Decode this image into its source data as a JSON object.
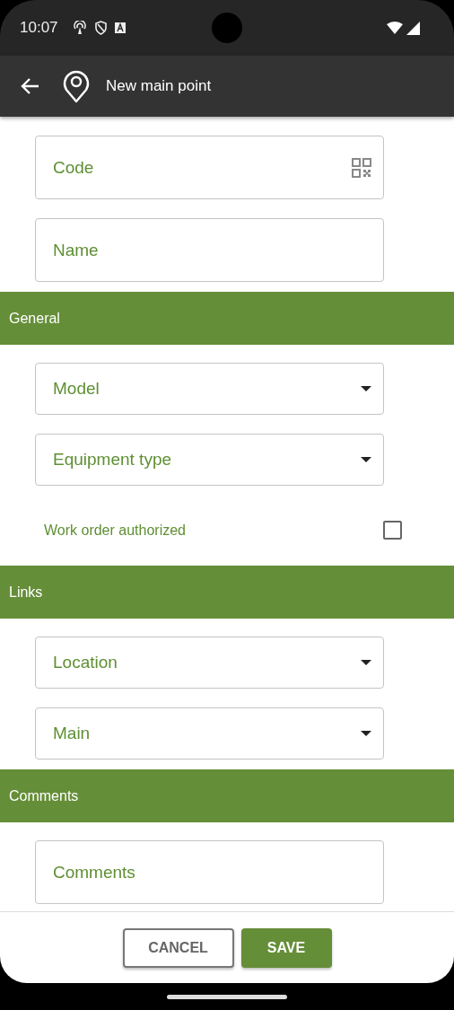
{
  "status_bar": {
    "time": "10:07"
  },
  "app_bar": {
    "title": "New main point"
  },
  "top_fields": [
    {
      "kind": "text",
      "placeholder": "Code",
      "qr": true
    },
    {
      "kind": "text",
      "placeholder": "Name",
      "qr": false
    }
  ],
  "sections": [
    {
      "title": "General",
      "fields": [
        {
          "kind": "select",
          "placeholder": "Model"
        },
        {
          "kind": "select",
          "placeholder": "Equipment type"
        },
        {
          "kind": "checkbox",
          "label": "Work order authorized",
          "checked": false
        }
      ]
    },
    {
      "title": "Links",
      "fields": [
        {
          "kind": "select",
          "placeholder": "Location"
        },
        {
          "kind": "select",
          "placeholder": "Main"
        }
      ]
    },
    {
      "title": "Comments",
      "fields": [
        {
          "kind": "text",
          "placeholder": "Comments",
          "qr": false
        }
      ]
    }
  ],
  "buttons": [
    {
      "label": "CANCEL",
      "kind": "outline"
    },
    {
      "label": "SAVE",
      "kind": "primary"
    }
  ]
}
